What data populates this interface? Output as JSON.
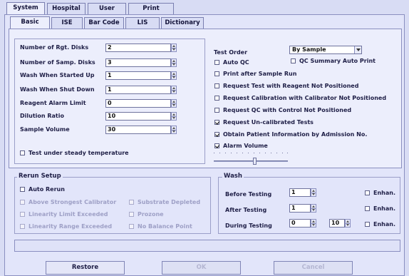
{
  "top_tabs": [
    {
      "label": "System",
      "active": true
    },
    {
      "label": "Hospital",
      "active": false
    },
    {
      "label": "User",
      "active": false
    },
    {
      "label": "Print",
      "active": false
    }
  ],
  "sub_tabs": [
    {
      "label": "Basic",
      "active": true
    },
    {
      "label": "ISE",
      "active": false
    },
    {
      "label": "Bar Code",
      "active": false
    },
    {
      "label": "LIS",
      "active": false
    },
    {
      "label": "Dictionary",
      "active": false
    }
  ],
  "settings": [
    {
      "label": "Number of Rgt. Disks",
      "value": "2"
    },
    {
      "label": "Number of Samp. Disks",
      "value": "3"
    },
    {
      "label": "Wash When Started Up",
      "value": "1"
    },
    {
      "label": "Wash When Shut Down",
      "value": "1"
    },
    {
      "label": "Reagent Alarm Limit",
      "value": "0"
    },
    {
      "label": "Dilution Ratio",
      "value": "10"
    },
    {
      "label": "Sample Volume",
      "value": "30"
    }
  ],
  "steady_temp": {
    "label": "Test under steady temperature",
    "checked": false
  },
  "test_order": {
    "label": "Test Order",
    "value": "By Sample"
  },
  "right_options": [
    {
      "label": "Auto QC",
      "checked": false
    },
    {
      "label": "Print after Sample Run",
      "checked": false
    },
    {
      "label": "Request Test with Reagent Not Positioned",
      "checked": false
    },
    {
      "label": "Request Calibration with Calibrator Not Positioned",
      "checked": false
    },
    {
      "label": "Request QC with Control Not Positioned",
      "checked": false
    },
    {
      "label": "Request Un-calibrated Tests",
      "checked": true
    },
    {
      "label": "Obtain Patient Information by Admission No.",
      "checked": true
    },
    {
      "label": "Alarm Volume",
      "checked": true
    }
  ],
  "qc_summary": {
    "label": "QC Summary Auto Print",
    "checked": false
  },
  "alarm_volume_level": 0.57,
  "rerun": {
    "title": "Rerun Setup",
    "auto_rerun": {
      "label": "Auto Rerun",
      "checked": false
    },
    "options": [
      {
        "label": "Above Strongest Calibrator"
      },
      {
        "label": "Substrate Depleted"
      },
      {
        "label": "Linearity Limit Exceeded"
      },
      {
        "label": "Prozone"
      },
      {
        "label": "Linearity Range Exceeded"
      },
      {
        "label": "No Balance Point"
      }
    ]
  },
  "wash": {
    "title": "Wash",
    "before": {
      "label": "Before Testing",
      "value": "1"
    },
    "after": {
      "label": "After Testing",
      "value": "1"
    },
    "during": {
      "label": "During Testing",
      "value": "0",
      "value2": "10"
    },
    "enhan_label": "Enhan."
  },
  "buttons": {
    "restore": "Restore",
    "ok": "OK",
    "cancel": "Cancel"
  }
}
